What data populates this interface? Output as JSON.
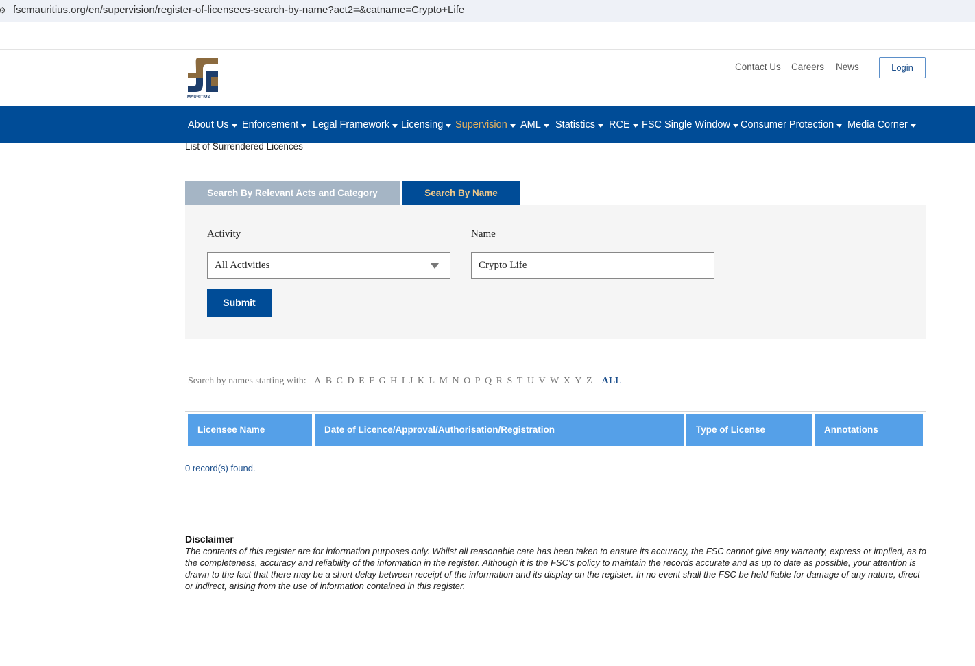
{
  "browser": {
    "url": "fscmauritius.org/en/supervision/register-of-licensees-search-by-name?act2=&catname=Crypto+Life",
    "url_icon": "site-settings-icon"
  },
  "header": {
    "logo_text": "MAURITIUS",
    "links": [
      "Contact Us",
      "Careers",
      "News"
    ],
    "login_label": "Login",
    "brand_colors": {
      "brown": "#8b6a3e",
      "navy": "#1d3d6b"
    }
  },
  "nav": {
    "items": [
      "About Us",
      "Enforcement",
      "Legal Framework",
      "Licensing",
      "Supervision",
      "AML",
      "Statistics",
      "RCE",
      "FSC Single Window",
      "Consumer Protection",
      "Media Corner"
    ],
    "active": "Supervision",
    "bg_color": "#004c97",
    "active_color": "#e8b25c"
  },
  "breadcrumb": "List of Surrendered Licences",
  "tabs": {
    "acts": "Search By Relevant Acts and Category",
    "name": "Search By Name",
    "active": "Search By Name"
  },
  "form": {
    "activity_label": "Activity",
    "activity_value": "All Activities",
    "name_label": "Name",
    "name_value": "Crypto Life",
    "submit_label": "Submit"
  },
  "alphabet": {
    "label": "Search by names starting with:",
    "letters": [
      "A",
      "B",
      "C",
      "D",
      "E",
      "F",
      "G",
      "H",
      "I",
      "J",
      "K",
      "L",
      "M",
      "N",
      "O",
      "P",
      "Q",
      "R",
      "S",
      "T",
      "U",
      "V",
      "W",
      "X",
      "Y",
      "Z"
    ],
    "all_label": "ALL"
  },
  "table": {
    "headers": [
      "Licensee Name",
      "Date of Licence/Approval/Authorisation/Registration",
      "Type of License",
      "Annotations"
    ],
    "header_color": "#55a0e8",
    "records_text": "0 record(s) found."
  },
  "disclaimer": {
    "title": "Disclaimer",
    "text": "The contents of this register are for information purposes only. Whilst all reasonable care has been taken to ensure its accuracy, the FSC cannot give any warranty, express or implied, as to the completeness, accuracy and reliability of the information in the register. Although it is the FSC's policy to maintain the records accurate and as up to date as possible, your attention is drawn to the fact that there may be a short delay between receipt of the information and its display on the register. In no event shall the FSC be held liable for damage of any nature, direct or indirect, arising from the use of information contained in this register."
  }
}
